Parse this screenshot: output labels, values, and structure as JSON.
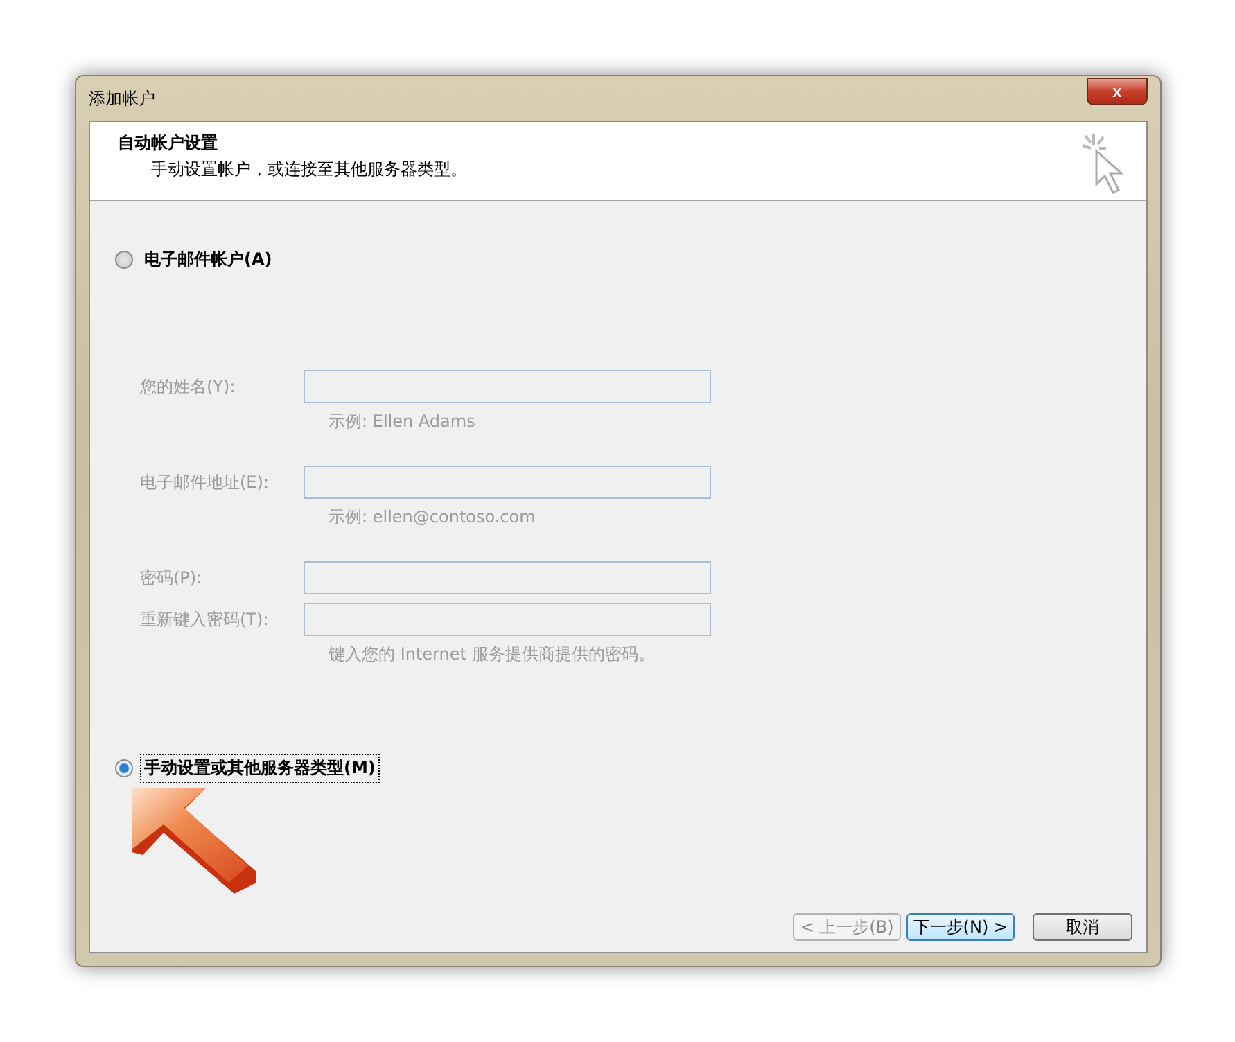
{
  "window": {
    "title": "添加帐户",
    "close": "x"
  },
  "header": {
    "title": "自动帐户设置",
    "subtitle": "手动设置帐户，或连接至其他服务器类型。"
  },
  "options": [
    {
      "label": "电子邮件帐户(A)",
      "selected": false
    },
    {
      "label": "手动设置或其他服务器类型(M)",
      "selected": true
    }
  ],
  "fields": [
    {
      "label": "您的姓名(Y):",
      "hint": "示例: Ellen Adams",
      "disabled": true
    },
    {
      "label": "电子邮件地址(E):",
      "hint": "示例: ellen@contoso.com",
      "disabled": true
    },
    {
      "label": "密码(P):",
      "disabled": true
    },
    {
      "label": "重新键入密码(T):",
      "hint": "键入您的 Internet 服务提供商提供的密码。",
      "disabled": true
    }
  ],
  "buttons": [
    {
      "label": "< 上一步(B)",
      "disabled": true,
      "default": false
    },
    {
      "label": "下一步(N) >",
      "disabled": false,
      "default": true
    },
    {
      "label": "取消",
      "disabled": false,
      "default": false
    }
  ]
}
